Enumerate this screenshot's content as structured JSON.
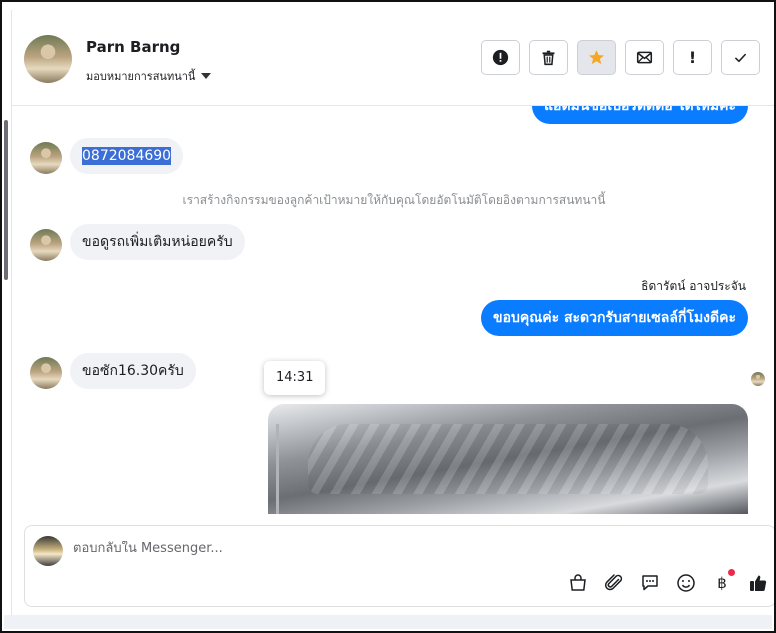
{
  "header": {
    "contact_name": "Parn Barng",
    "assign_label": "มอบหมายการสนทนานี้"
  },
  "toolbar": {
    "buttons": [
      "alert-circle-icon",
      "trash-icon",
      "star-icon",
      "envelope-icon",
      "exclamation-icon",
      "check-icon"
    ],
    "exclaim_glyph": "!",
    "star_color": "#f5a623"
  },
  "messages": {
    "top_partial": "แอดมินขอเบอร์ติดต่อ ได้ไหมคะ",
    "phone": "0872084690",
    "system_note": "เราสร้างกิจกรรมของลูกค้าเป้าหมายให้กับคุณโดยอัตโนมัติโดยอิงตามการสนทนานี้",
    "msg_more_info": "ขอดูรถเพิ่มเติมหน่อยครับ",
    "agent_name": "ธิดารัตน์ อาจประจัน",
    "msg_thanks": "ขอบคุณค่ะ สะดวกรับสายเซลล์กี่โมงดีคะ",
    "msg_time_reply": "ขอซัก16.30ครับ",
    "tooltip_time": "14:31"
  },
  "composer": {
    "placeholder": "ตอบกลับใน Messenger...",
    "tools": [
      "shopping-bag-icon",
      "paperclip-icon",
      "chat-bubble-icon",
      "smiley-icon",
      "baht-icon",
      "thumbs-up-icon"
    ],
    "baht_glyph": "฿",
    "notification_color": "#f02849"
  },
  "colors": {
    "accent": "#0a7cff",
    "incoming_bubble": "#f0f2f5",
    "selection": "#3b6fd6"
  }
}
